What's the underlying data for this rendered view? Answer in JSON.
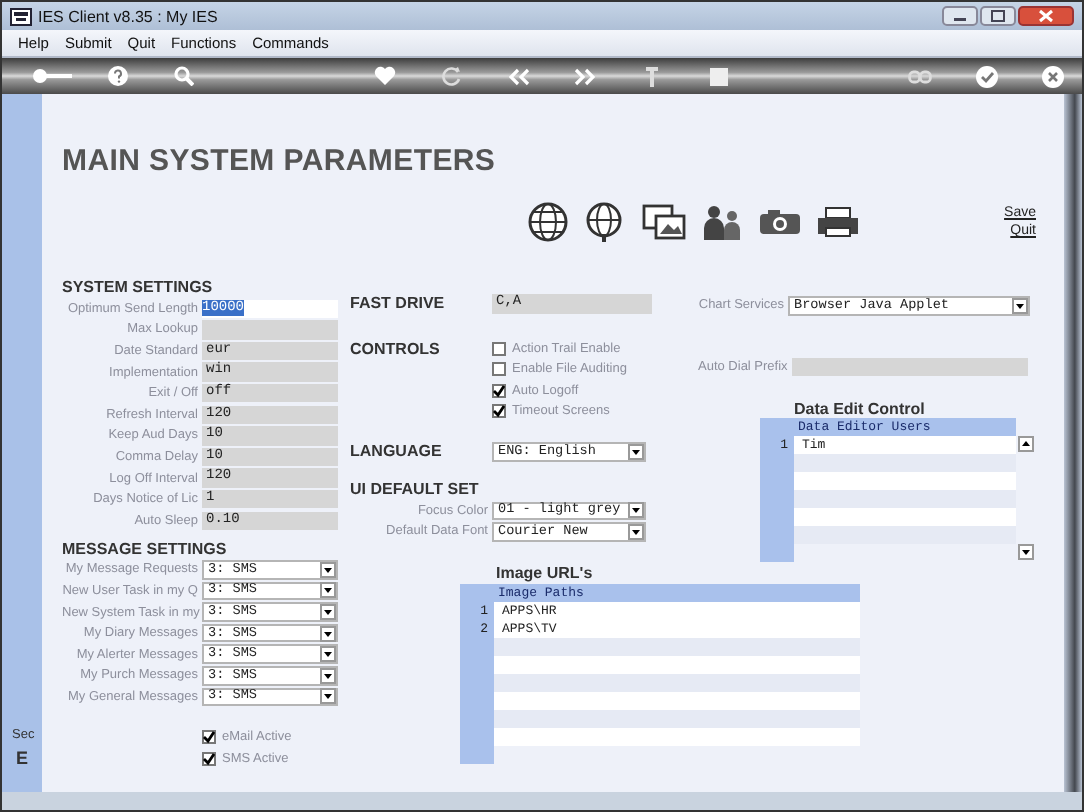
{
  "window": {
    "title": "IES Client v8.35 : My IES"
  },
  "menu": [
    "Help",
    "Submit",
    "Quit",
    "Functions",
    "Commands"
  ],
  "side_panel": {
    "texts": [
      "Sec",
      "E"
    ]
  },
  "page": {
    "title": "MAIN SYSTEM PARAMETERS",
    "links": [
      "Save",
      "Quit"
    ]
  },
  "system_settings": {
    "title": "SYSTEM SETTINGS",
    "fields": [
      {
        "label": "Optimum Send Length",
        "value": "10000",
        "selected": true
      },
      {
        "label": "Max Lookup",
        "selected": false
      },
      {
        "label": "Date Standard",
        "value": "eur",
        "selected": false
      },
      {
        "label": "Implementation",
        "value": "win",
        "selected": false
      },
      {
        "label": "Exit / Off",
        "value": "off",
        "selected": false
      },
      {
        "label": "Refresh Interval",
        "value": "120",
        "selected": false
      },
      {
        "label": "Keep Aud Days",
        "value": "10",
        "selected": false
      },
      {
        "label": "Comma Delay",
        "value": "10",
        "selected": false
      },
      {
        "label": "Log Off Interval",
        "value": "120",
        "selected": false
      },
      {
        "label": "Days Notice of Lic",
        "value": "1",
        "selected": false
      },
      {
        "label": "Auto Sleep",
        "value": "0.10",
        "selected": false
      }
    ]
  },
  "message_settings": {
    "title": "MESSAGE SETTINGS",
    "rows": [
      {
        "label": "My Message Requests",
        "value": "3: SMS"
      },
      {
        "label": "New User Task in my Q",
        "value": "3: SMS"
      },
      {
        "label": "New System Task in my",
        "value": "3: SMS"
      },
      {
        "label": "My Diary Messages",
        "value": "3: SMS"
      },
      {
        "label": "My Alerter Messages",
        "value": "3: SMS"
      },
      {
        "label": "My Purch Messages",
        "value": "3: SMS"
      },
      {
        "label": "My General Messages",
        "value": "3: SMS"
      }
    ]
  },
  "notification_checks": [
    {
      "label": "eMail Active",
      "checked": true
    },
    {
      "label": "SMS Active",
      "checked": true
    }
  ],
  "fast_drive": {
    "title": "FAST DRIVE",
    "value": "C,A"
  },
  "controls": {
    "title": "CONTROLS",
    "options": [
      {
        "label": "Action Trail Enable",
        "checked": false
      },
      {
        "label": "Enable File Auditing",
        "checked": false
      },
      {
        "label": "Auto Logoff",
        "checked": true
      },
      {
        "label": "Timeout Screens",
        "checked": true
      }
    ]
  },
  "language": {
    "title": "LANGUAGE",
    "value": "ENG: English"
  },
  "ui_default_set": {
    "title": "UI DEFAULT SET",
    "rows": [
      {
        "label": "Focus Color",
        "value": "01 - light grey"
      },
      {
        "label": "Default Data Font",
        "value": "Courier New"
      }
    ]
  },
  "chart_services": {
    "label": "Chart Services",
    "value": "Browser Java Applet"
  },
  "auto_dial_prefix": {
    "label": "Auto Dial Prefix"
  },
  "data_edit_control": {
    "title": "Data Edit Control",
    "column": "Data Editor Users",
    "rows": [
      {
        "number": "1",
        "name": "Tim"
      }
    ]
  },
  "image_urls": {
    "title": "Image URL's",
    "column": "Image Paths",
    "rows": [
      {
        "number": "1",
        "path": "APPS\\HR"
      },
      {
        "number": "2",
        "path": "APPS\\TV"
      }
    ]
  }
}
